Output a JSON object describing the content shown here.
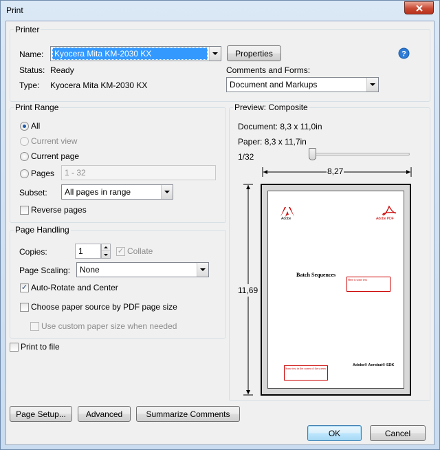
{
  "window": {
    "title": "Print"
  },
  "printer": {
    "group_label": "Printer",
    "name_label": "Name:",
    "name_value": "Kyocera Mita KM-2030 KX",
    "status_label": "Status:",
    "status_value": "Ready",
    "type_label": "Type:",
    "type_value": "Kyocera Mita KM-2030 KX",
    "properties_label": "Properties",
    "comments_label": "Comments and Forms:",
    "comments_value": "Document and Markups"
  },
  "range": {
    "group_label": "Print Range",
    "all_label": "All",
    "current_view_label": "Current view",
    "current_page_label": "Current page",
    "pages_label": "Pages",
    "pages_value": "1 - 32",
    "subset_label": "Subset:",
    "subset_value": "All pages in range",
    "reverse_label": "Reverse pages"
  },
  "handling": {
    "group_label": "Page Handling",
    "copies_label": "Copies:",
    "copies_value": "1",
    "collate_label": "Collate",
    "scaling_label": "Page Scaling:",
    "scaling_value": "None",
    "autorotate_label": "Auto-Rotate and Center",
    "paper_source_label": "Choose paper source by PDF page size",
    "custom_size_label": "Use custom paper size when needed"
  },
  "print_to_file_label": "Print to file",
  "preview": {
    "group_label": "Preview: Composite",
    "document_size": "Document: 8,3 x 11,0in",
    "paper_size": "Paper: 8,3 x 11,7in",
    "page_indicator": "1/32",
    "page_position": 0.0,
    "width_label": "8,27",
    "height_label": "11,69",
    "page": {
      "heading": "Batch Sequences",
      "pdf_logo_text": "Adobe PDF",
      "adobe_text": "Adobe",
      "footer_brand": "Adobe® Acrobat® SDK",
      "annotation_1": "Here is some text",
      "annotation_2": "Some text in the corner of the screen"
    }
  },
  "buttons": {
    "page_setup": "Page Setup...",
    "advanced": "Advanced",
    "summarize": "Summarize Comments",
    "ok": "OK",
    "cancel": "Cancel"
  },
  "icons": {
    "help": "help-icon",
    "close": "close-icon",
    "dropdown": "chevron-down-icon"
  },
  "colors": {
    "selection": "#3399ff",
    "annotation": "#cc0000",
    "help_blue": "#2e7bd6"
  }
}
